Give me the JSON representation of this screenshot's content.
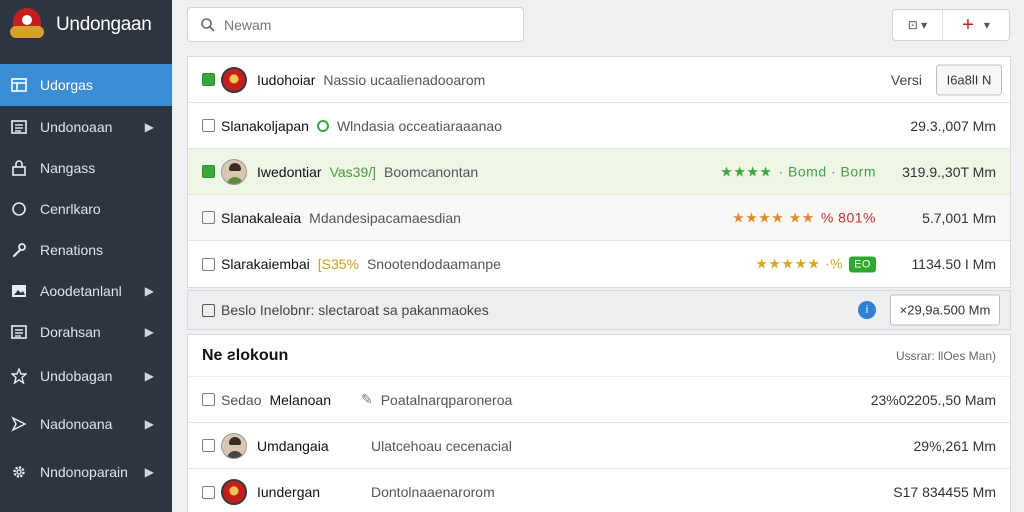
{
  "app": {
    "title": "Undongaan"
  },
  "sidebar": {
    "items": [
      {
        "label": "Udorgas",
        "icon": "dashboard-icon",
        "active": true,
        "chevron": false
      },
      {
        "label": "Undonoaan",
        "icon": "list-icon",
        "active": false,
        "chevron": true
      },
      {
        "label": "Nangass",
        "icon": "lock-icon",
        "active": false,
        "chevron": false
      },
      {
        "label": "Cenrlkaro",
        "icon": "circle-icon",
        "active": false,
        "chevron": false
      },
      {
        "label": "Renations",
        "icon": "wrench-icon",
        "active": false,
        "chevron": false
      },
      {
        "label": "Aoodetanlanl",
        "icon": "image-icon",
        "active": false,
        "chevron": true
      },
      {
        "label": "Dorahsan",
        "icon": "list-icon",
        "active": false,
        "chevron": true
      },
      {
        "label": "Undobagan",
        "icon": "star-icon",
        "active": false,
        "chevron": true
      },
      {
        "label": "Nadonoana",
        "icon": "send-icon",
        "active": false,
        "chevron": true
      },
      {
        "label": "Nndonoparain",
        "icon": "gear-icon",
        "active": false,
        "chevron": true
      }
    ]
  },
  "search": {
    "placeholder": "Newam"
  },
  "toolbar": {
    "left_label": "⊡ ▾",
    "right_label": "▾"
  },
  "list": {
    "rows": [
      {
        "name": "Iudohoiar",
        "desc": "Nassio ucaalienadooarom",
        "version_label": "Versi",
        "version_btn": "I6a8lI N"
      },
      {
        "name": "Slanakoljapan",
        "desc": "Wlndasia occeatiaraaanao",
        "value": "29.3.,007 Mm"
      },
      {
        "name": "Iwedontiar",
        "desc_prefix": "Vas39/]",
        "desc": "Boomcanontan",
        "stars": "★★★★",
        "rating_text": "· Bomd · Borm",
        "value": "319.9.,30T Mm"
      },
      {
        "name": "Slanakaleaia",
        "desc": "Mdandesipacamaesdian",
        "stars": "★★★★ ★★",
        "pct": "% 801%",
        "value": "5.7,001 Mm"
      },
      {
        "name": "Slarakaiembai",
        "desc_prefix": "[S35%",
        "desc": "Snootendodaamanpe",
        "stars": "★★★★★ ·%",
        "badge": "EO",
        "value": "1134.50 I Mm"
      }
    ]
  },
  "infobar": {
    "text": "Beslo Inelobnr: slectaroat sa pakanmaokes",
    "info_icon": "i",
    "btn_label": "×29,9a.500 Mm"
  },
  "section": {
    "title": "Ne ƨlokoun",
    "meta": "Ussrar: llOes Man)",
    "rows": [
      {
        "prefix": "Sedao",
        "name": "Melanoan",
        "desc": "Poatalnarqparoneroa",
        "value": "23%02205.,50 Mam"
      },
      {
        "name": "Umdangaia",
        "desc": "Ulatcehoau cecenacial",
        "value": "29%,261 Mm"
      },
      {
        "name": "Iundergan",
        "desc": "Dontolnaaenarorom",
        "value": "S17 834455 Mm"
      }
    ]
  }
}
